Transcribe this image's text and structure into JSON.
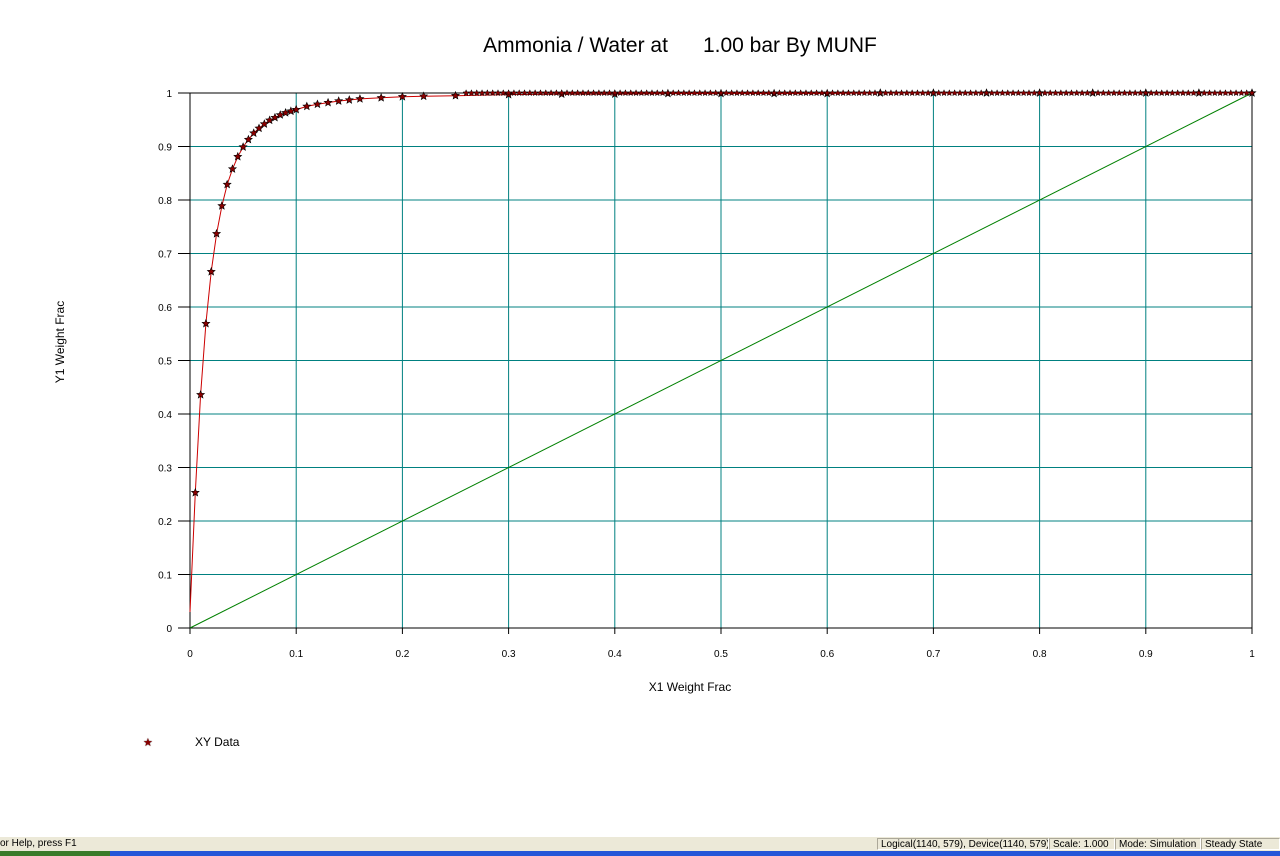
{
  "chart_data": {
    "type": "scatter",
    "title": "Ammonia / Water at      1.00 bar By MUNF",
    "xlabel": "X1 Weight Frac",
    "ylabel": "Y1 Weight Frac",
    "xlim": [
      0,
      1
    ],
    "ylim": [
      0,
      1
    ],
    "x_ticks": [
      "0",
      "0.1",
      "0.2",
      "0.3",
      "0.4",
      "0.5",
      "0.6",
      "0.7",
      "0.8",
      "0.9",
      "1"
    ],
    "y_ticks": [
      "0",
      "0.1",
      "0.2",
      "0.3",
      "0.4",
      "0.5",
      "0.6",
      "0.7",
      "0.8",
      "0.9",
      "1"
    ],
    "grid": true,
    "legend_position": "bottom-left",
    "series": [
      {
        "name": "XY Data",
        "marker": "star",
        "color": "#cc0000",
        "marker_color": "#8b0000",
        "line": true,
        "x": [
          0,
          0.005,
          0.01,
          0.015,
          0.02,
          0.025,
          0.03,
          0.035,
          0.04,
          0.045,
          0.05,
          0.055,
          0.06,
          0.065,
          0.07,
          0.075,
          0.08,
          0.085,
          0.09,
          0.095,
          0.1,
          0.11,
          0.12,
          0.13,
          0.14,
          0.15,
          0.16,
          0.18,
          0.2,
          0.22,
          0.25,
          0.3,
          0.35,
          0.4,
          0.45,
          0.5,
          0.55,
          0.6,
          0.65,
          0.7,
          0.75,
          0.8,
          0.85,
          0.9,
          0.95,
          1.0
        ],
        "y": [
          0.03,
          0.253,
          0.436,
          0.569,
          0.666,
          0.737,
          0.789,
          0.829,
          0.858,
          0.881,
          0.899,
          0.913,
          0.925,
          0.934,
          0.942,
          0.949,
          0.954,
          0.959,
          0.963,
          0.966,
          0.969,
          0.975,
          0.979,
          0.982,
          0.985,
          0.987,
          0.989,
          0.991,
          0.993,
          0.994,
          0.995,
          0.997,
          0.998,
          0.998,
          0.999,
          0.999,
          0.999,
          0.999,
          1.0,
          1.0,
          1.0,
          1.0,
          1.0,
          1.0,
          1.0,
          1.0
        ]
      },
      {
        "name": "",
        "line": true,
        "color": "#008000",
        "x": [
          0,
          1
        ],
        "y": [
          0,
          1
        ]
      }
    ]
  },
  "statusbar": {
    "help": "or Help, press F1",
    "coords": "Logical(1140, 579), Device(1140, 579)",
    "scale": "Scale: 1.000",
    "mode": "Mode: Simulation",
    "state": "Steady State"
  }
}
